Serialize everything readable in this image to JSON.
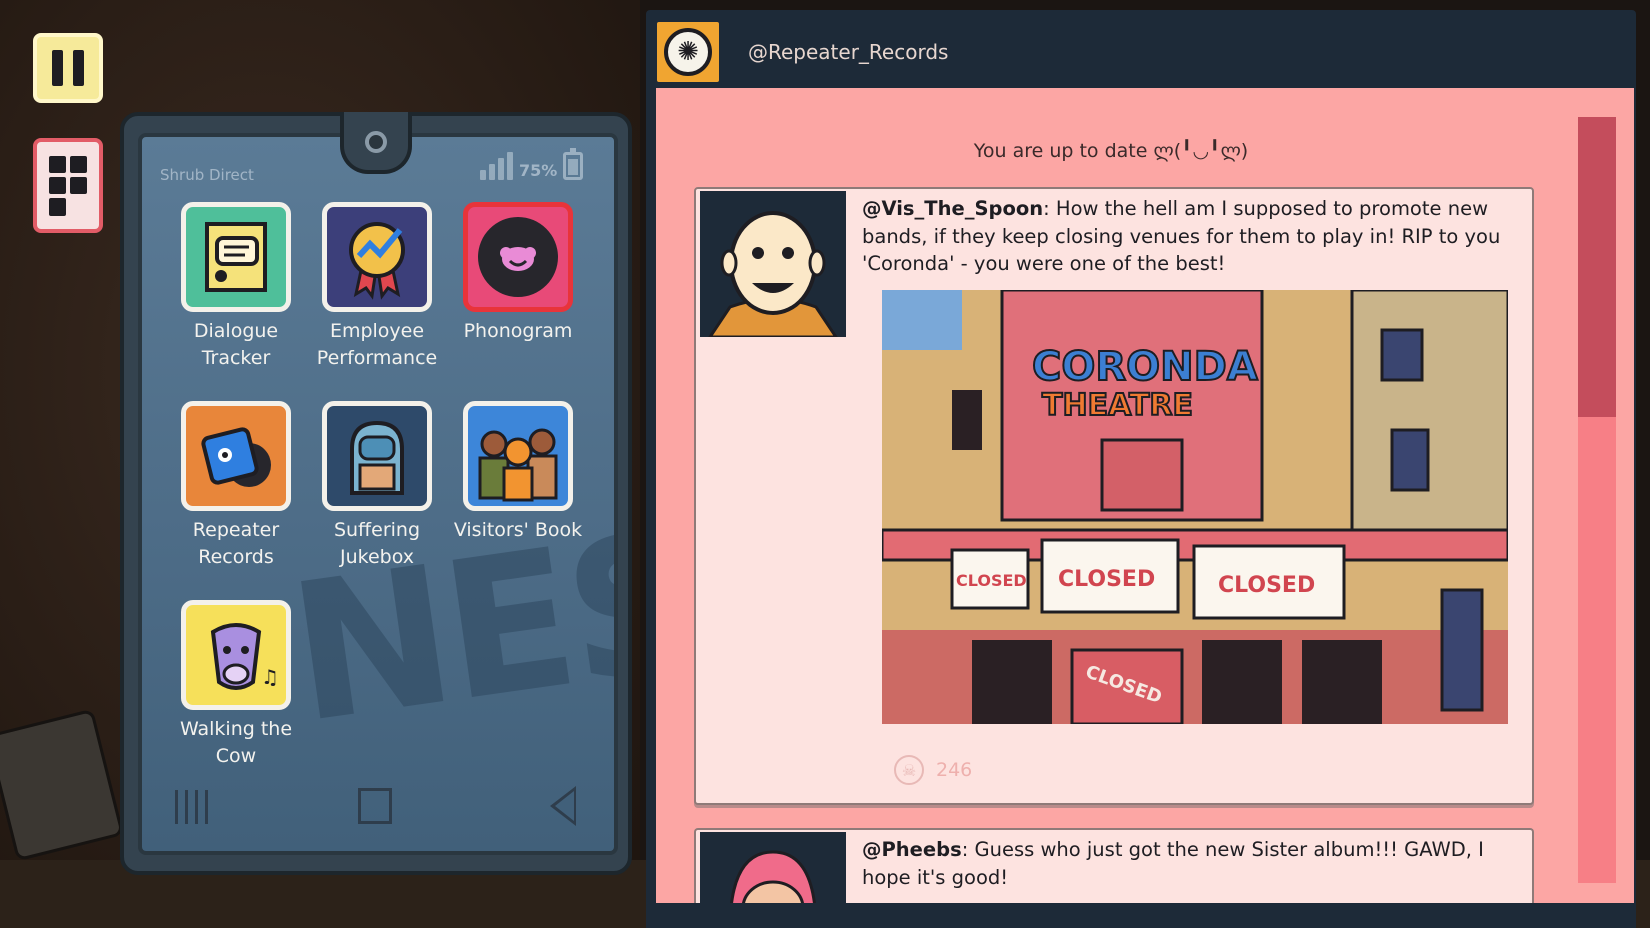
{
  "hud": {
    "pause_icon": "pause-icon",
    "phone_icon": "phone-apps-icon"
  },
  "phone": {
    "carrier": "Shrub Direct",
    "battery": "75%",
    "battery_level": 0.75,
    "signal_bars": 4,
    "apps": [
      {
        "label": "Dialogue\nTracker",
        "icon": "notepad-speech-icon",
        "color": "#4fbf9a"
      },
      {
        "label": "Employee\nPerformance",
        "icon": "award-chart-icon",
        "color": "#3c3f7a"
      },
      {
        "label": "Phonogram",
        "icon": "phonogram-face-icon",
        "color": "#e84a78"
      },
      {
        "label": "Repeater\nRecords",
        "icon": "record-box-icon",
        "color": "#e8863a"
      },
      {
        "label": "Suffering\nJukebox",
        "icon": "jukebox-icon",
        "color": "#2e4a6a"
      },
      {
        "label": "Visitors' Book",
        "icon": "visitors-group-icon",
        "color": "#3d86d9"
      },
      {
        "label": "Walking the\nCow",
        "icon": "cow-music-icon",
        "color": "#f6e05a"
      }
    ],
    "nav": {
      "recent_icon": "recent-apps-icon",
      "home_icon": "home-icon",
      "back_icon": "back-icon"
    },
    "wallpaper_text": "NES"
  },
  "social": {
    "handle": "@Repeater_Records",
    "status": "You are up to date ლ(╹◡╹ლ)",
    "posts": [
      {
        "user": "@Vis_The_Spoon",
        "text": ": How the hell am I supposed to promote new bands, if they keep closing venues for them to play in! RIP to you 'Coronda' - you were one of the best!",
        "image": {
          "sign_line1": "CORONDA",
          "sign_line2": "THEATRE",
          "banners": [
            "CLOSED",
            "CLOSED",
            "CLOSED"
          ],
          "door_sign": "CLOSED"
        },
        "likes": "246"
      },
      {
        "user": "@Pheebs",
        "text": ": Guess who just got the new Sister album!!! GAWD, I hope it's good!"
      }
    ]
  }
}
